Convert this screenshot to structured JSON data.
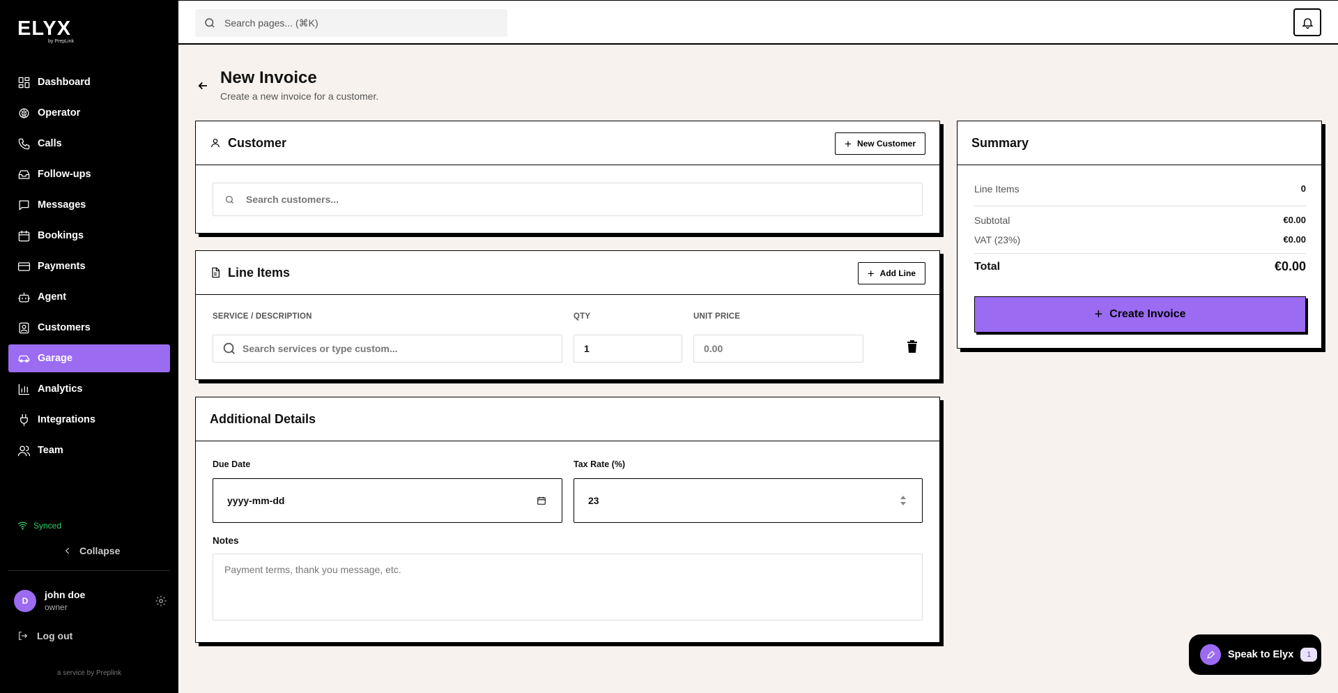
{
  "brand": {
    "logo": "ELYX",
    "tagline": "by PrepLink"
  },
  "sidebar": {
    "items": [
      {
        "label": "Dashboard",
        "icon": "dashboard-icon"
      },
      {
        "label": "Operator",
        "icon": "brain-icon"
      },
      {
        "label": "Calls",
        "icon": "phone-icon"
      },
      {
        "label": "Follow-ups",
        "icon": "inbox-icon"
      },
      {
        "label": "Messages",
        "icon": "message-icon"
      },
      {
        "label": "Bookings",
        "icon": "calendar-icon"
      },
      {
        "label": "Payments",
        "icon": "card-icon"
      },
      {
        "label": "Agent",
        "icon": "bot-icon"
      },
      {
        "label": "Customers",
        "icon": "contact-icon"
      },
      {
        "label": "Garage",
        "icon": "car-icon",
        "active": true
      },
      {
        "label": "Analytics",
        "icon": "chart-icon"
      },
      {
        "label": "Integrations",
        "icon": "plug-icon"
      },
      {
        "label": "Team",
        "icon": "users-icon"
      }
    ],
    "status": "Synced",
    "collapse_label": "Collapse",
    "user": {
      "initial": "D",
      "name": "john doe",
      "role": "owner"
    },
    "logout_label": "Log out",
    "footer": "a service by Preplink"
  },
  "topbar": {
    "search_placeholder": "Search pages... (⌘K)"
  },
  "page": {
    "title": "New Invoice",
    "subtitle": "Create a new invoice for a customer."
  },
  "customer": {
    "title": "Customer",
    "new_button": "New Customer",
    "search_placeholder": "Search customers..."
  },
  "line_items": {
    "title": "Line Items",
    "add_button": "Add Line",
    "columns": {
      "description": "SERVICE / DESCRIPTION",
      "qty": "QTY",
      "unit_price": "UNIT PRICE"
    },
    "rows": [
      {
        "description_placeholder": "Search services or type custom...",
        "qty": "1",
        "unit_price_placeholder": "0.00"
      }
    ]
  },
  "details": {
    "title": "Additional Details",
    "due_date_label": "Due Date",
    "due_date_placeholder": "yyyy-mm-dd",
    "tax_rate_label": "Tax Rate (%)",
    "tax_rate_value": "23",
    "notes_label": "Notes",
    "notes_placeholder": "Payment terms, thank you message, etc."
  },
  "summary": {
    "title": "Summary",
    "line_items_label": "Line Items",
    "line_items_count": "0",
    "subtotal_label": "Subtotal",
    "subtotal_value": "€0.00",
    "vat_label": "VAT (23%)",
    "vat_value": "€0.00",
    "total_label": "Total",
    "total_value": "€0.00",
    "create_button": "Create Invoice"
  },
  "assistant": {
    "label": "Speak to Elyx",
    "badge": "1"
  },
  "colors": {
    "accent": "#9b6bf2",
    "sidebar_bg": "#000000",
    "page_bg": "#f7f2ee",
    "synced": "#2fd06a"
  }
}
